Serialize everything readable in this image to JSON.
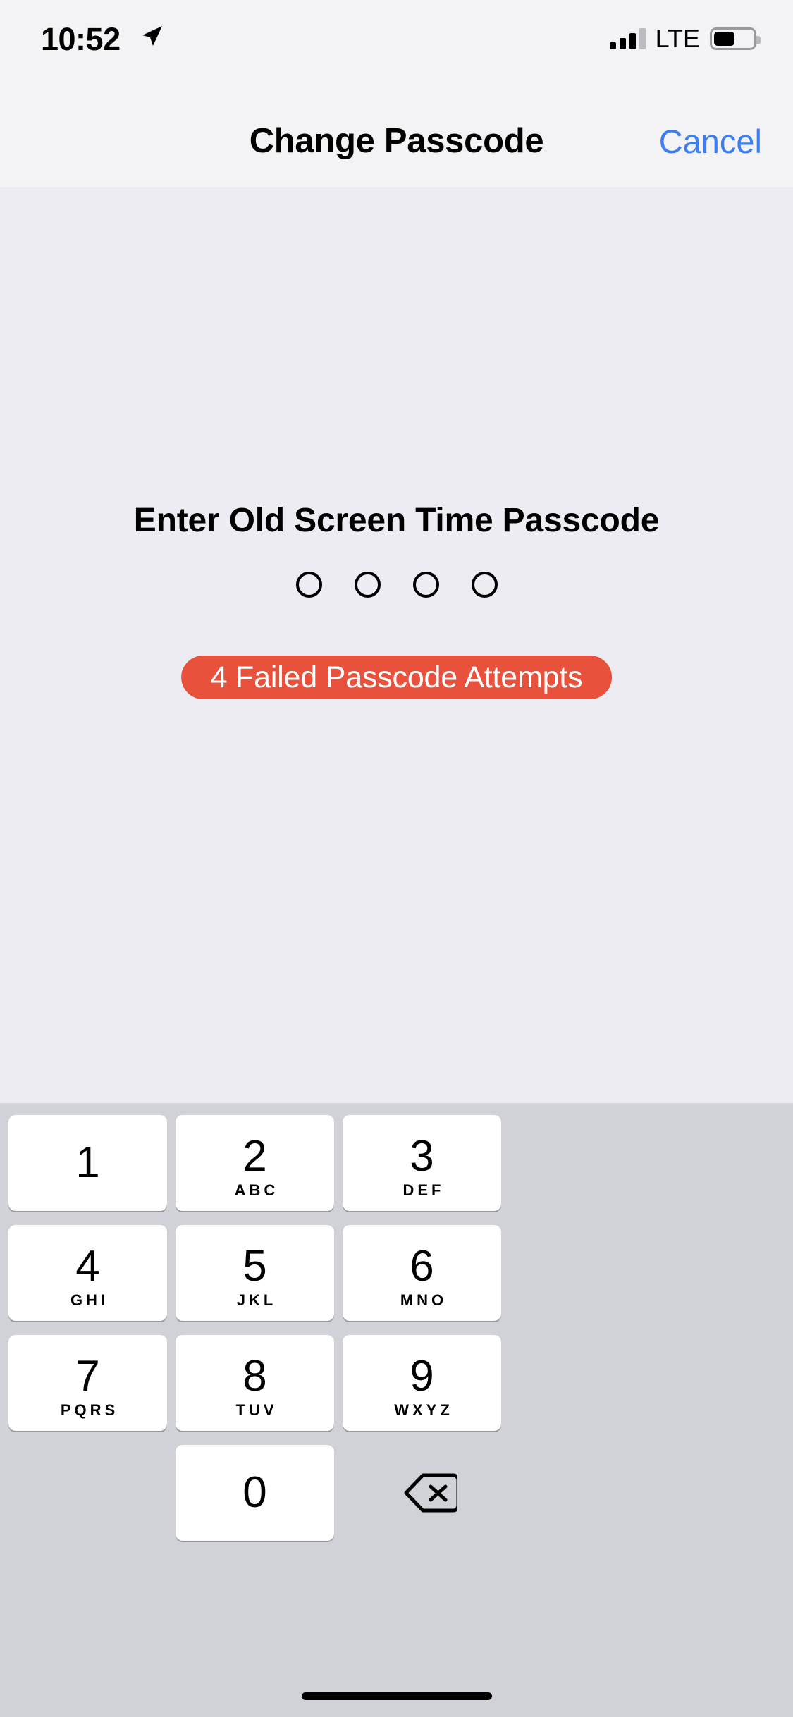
{
  "status_bar": {
    "time": "10:52",
    "location_icon": "location-arrow-icon",
    "signal_icon": "cellular-signal-icon",
    "signal_bars_filled": 3,
    "signal_bars_total": 4,
    "carrier_network": "LTE",
    "battery_icon": "battery-icon",
    "battery_level_percent": 50
  },
  "nav_bar": {
    "title": "Change Passcode",
    "cancel_label": "Cancel",
    "cancel_color": "#3C7DF0"
  },
  "content": {
    "prompt": "Enter Old Screen Time Passcode",
    "passcode_length": 4,
    "filled_count": 0,
    "error_message": "4 Failed Passcode Attempts",
    "error_color": "#E8513B",
    "background_color": "#EDECF2"
  },
  "keypad": {
    "background_color": "#D1D2D7",
    "keys": [
      {
        "digit": "1",
        "letters": ""
      },
      {
        "digit": "2",
        "letters": "ABC"
      },
      {
        "digit": "3",
        "letters": "DEF"
      },
      {
        "digit": "4",
        "letters": "GHI"
      },
      {
        "digit": "5",
        "letters": "JKL"
      },
      {
        "digit": "6",
        "letters": "MNO"
      },
      {
        "digit": "7",
        "letters": "PQRS"
      },
      {
        "digit": "8",
        "letters": "TUV"
      },
      {
        "digit": "9",
        "letters": "WXYZ"
      },
      {
        "digit": "0",
        "letters": ""
      }
    ],
    "delete_icon": "delete-backspace-icon"
  },
  "home_indicator": {
    "icon": "home-indicator"
  }
}
